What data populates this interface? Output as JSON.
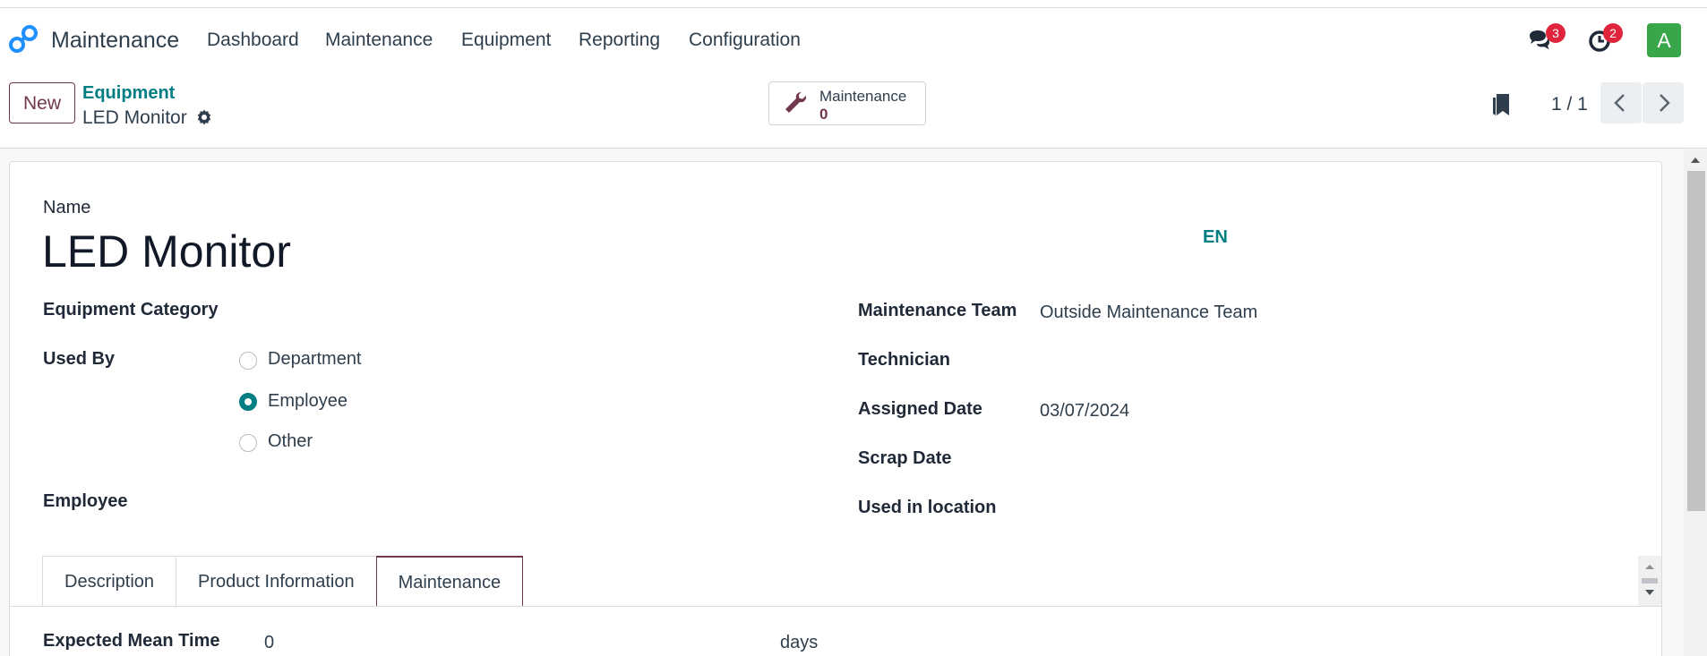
{
  "app": {
    "name": "Maintenance",
    "menu": [
      "Dashboard",
      "Maintenance",
      "Equipment",
      "Reporting",
      "Configuration"
    ],
    "messages_count": "3",
    "activities_count": "2",
    "user_initial": "A",
    "accent_color": "#017e84",
    "brand_color": "#71374f"
  },
  "control": {
    "new_label": "New",
    "breadcrumb_parent": "Equipment",
    "breadcrumb_current": "LED Monitor",
    "smart_button_label": "Maintenance",
    "smart_button_value": "0",
    "pager": "1 / 1"
  },
  "form": {
    "name_label": "Name",
    "name_value": "LED Monitor",
    "language": "EN",
    "equipment_category_label": "Equipment Category",
    "used_by_label": "Used By",
    "used_by_options": [
      "Department",
      "Employee",
      "Other"
    ],
    "used_by_selected": "Employee",
    "employee_label": "Employee",
    "maintenance_team_label": "Maintenance Team",
    "maintenance_team_value": "Outside Maintenance Team",
    "technician_label": "Technician",
    "assigned_date_label": "Assigned Date",
    "assigned_date_value": "03/07/2024",
    "scrap_date_label": "Scrap Date",
    "location_label": "Used in location"
  },
  "tabs": [
    "Description",
    "Product Information",
    "Maintenance"
  ],
  "active_tab": "Maintenance",
  "maintenance_tab": {
    "expected_mean_time_label": "Expected Mean Time",
    "expected_mean_time_value": "0",
    "unit": "days"
  }
}
